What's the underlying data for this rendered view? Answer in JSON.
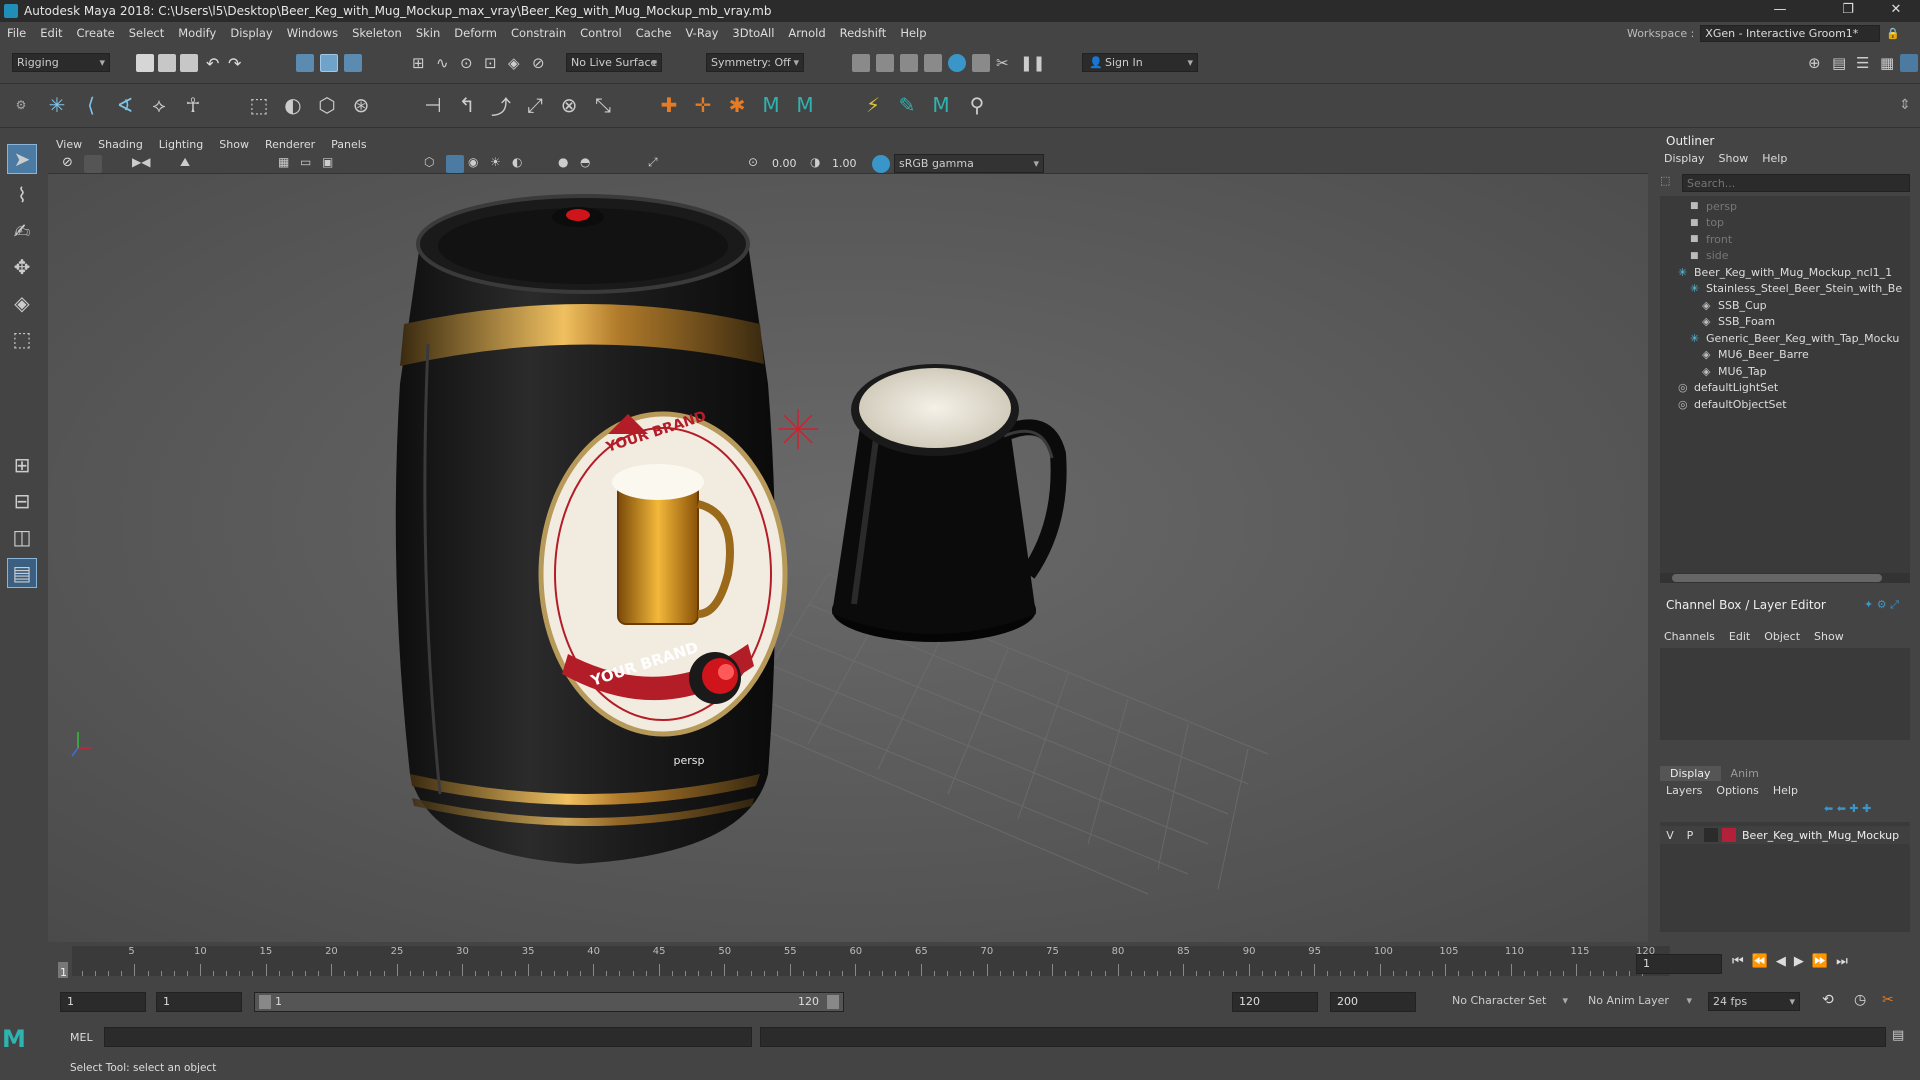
{
  "window": {
    "title": "Autodesk Maya 2018: C:\\Users\\l5\\Desktop\\Beer_Keg_with_Mug_Mockup_max_vray\\Beer_Keg_with_Mug_Mockup_mb_vray.mb"
  },
  "menubar": [
    "File",
    "Edit",
    "Create",
    "Select",
    "Modify",
    "Display",
    "Windows",
    "Skeleton",
    "Skin",
    "Deform",
    "Constrain",
    "Control",
    "Cache",
    "V-Ray",
    "3DtoAll",
    "Arnold",
    "Redshift",
    "Help"
  ],
  "workspace": {
    "label": "Workspace :",
    "value": "XGen - Interactive Groom1*"
  },
  "statusline": {
    "mode": "Rigging",
    "live_surface": "No Live Surface",
    "symmetry": "Symmetry: Off",
    "sign_in": "Sign In"
  },
  "viewport": {
    "menu": [
      "View",
      "Shading",
      "Lighting",
      "Show",
      "Renderer",
      "Panels"
    ],
    "exposure": "0.00",
    "gamma": "1.00",
    "color_space": "sRGB gamma",
    "camera_label": "persp"
  },
  "label_text": {
    "top": "YOUR BRAND",
    "bottom": "YOUR BRAND"
  },
  "outliner": {
    "title": "Outliner",
    "menu": [
      "Display",
      "Show",
      "Help"
    ],
    "search_placeholder": "Search...",
    "items": [
      {
        "label": "persp",
        "level": 1,
        "icon": "camera-icon",
        "dim": true
      },
      {
        "label": "top",
        "level": 1,
        "icon": "camera-icon",
        "dim": true
      },
      {
        "label": "front",
        "level": 1,
        "icon": "camera-icon",
        "dim": true
      },
      {
        "label": "side",
        "level": 1,
        "icon": "camera-icon",
        "dim": true
      },
      {
        "label": "Beer_Keg_with_Mug_Mockup_ncl1_1",
        "level": 0,
        "icon": "group-icon",
        "dim": false
      },
      {
        "label": "Stainless_Steel_Beer_Stein_with_Be",
        "level": 1,
        "icon": "group-icon",
        "dim": false
      },
      {
        "label": "SSB_Cup",
        "level": 2,
        "icon": "mesh-icon",
        "dim": false
      },
      {
        "label": "SSB_Foam",
        "level": 2,
        "icon": "mesh-icon",
        "dim": false
      },
      {
        "label": "Generic_Beer_Keg_with_Tap_Mocku",
        "level": 1,
        "icon": "group-icon",
        "dim": false
      },
      {
        "label": "MU6_Beer_Barre",
        "level": 2,
        "icon": "mesh-icon",
        "dim": false
      },
      {
        "label": "MU6_Tap",
        "level": 2,
        "icon": "mesh-icon",
        "dim": false
      },
      {
        "label": "defaultLightSet",
        "level": 0,
        "icon": "set-icon",
        "dim": false
      },
      {
        "label": "defaultObjectSet",
        "level": 0,
        "icon": "set-icon",
        "dim": false
      }
    ]
  },
  "channelbox": {
    "title": "Channel Box / Layer Editor",
    "menu": [
      "Channels",
      "Edit",
      "Object",
      "Show"
    ],
    "tabs": [
      "Display",
      "Anim"
    ],
    "layer_menu": [
      "Layers",
      "Options",
      "Help"
    ],
    "layer": {
      "v": "V",
      "p": "P",
      "name": "Beer_Keg_with_Mug_Mockup",
      "color": "#b3203a"
    }
  },
  "timeline": {
    "ticks": [
      "5",
      "10",
      "15",
      "20",
      "25",
      "30",
      "35",
      "40",
      "45",
      "50",
      "55",
      "60",
      "65",
      "70",
      "75",
      "80",
      "85",
      "90",
      "95",
      "100",
      "105",
      "110",
      "115",
      "120"
    ],
    "current_frame": "1",
    "frame_field": "1"
  },
  "range": {
    "start": "1",
    "start2": "1",
    "slider_start": "1",
    "slider_end": "120",
    "end": "120",
    "end2": "200",
    "character_set": "No Character Set",
    "anim_layer": "No Anim Layer",
    "fps": "24 fps"
  },
  "cmdline": {
    "label": "MEL"
  },
  "helpline": {
    "text": "Select Tool: select an object"
  }
}
